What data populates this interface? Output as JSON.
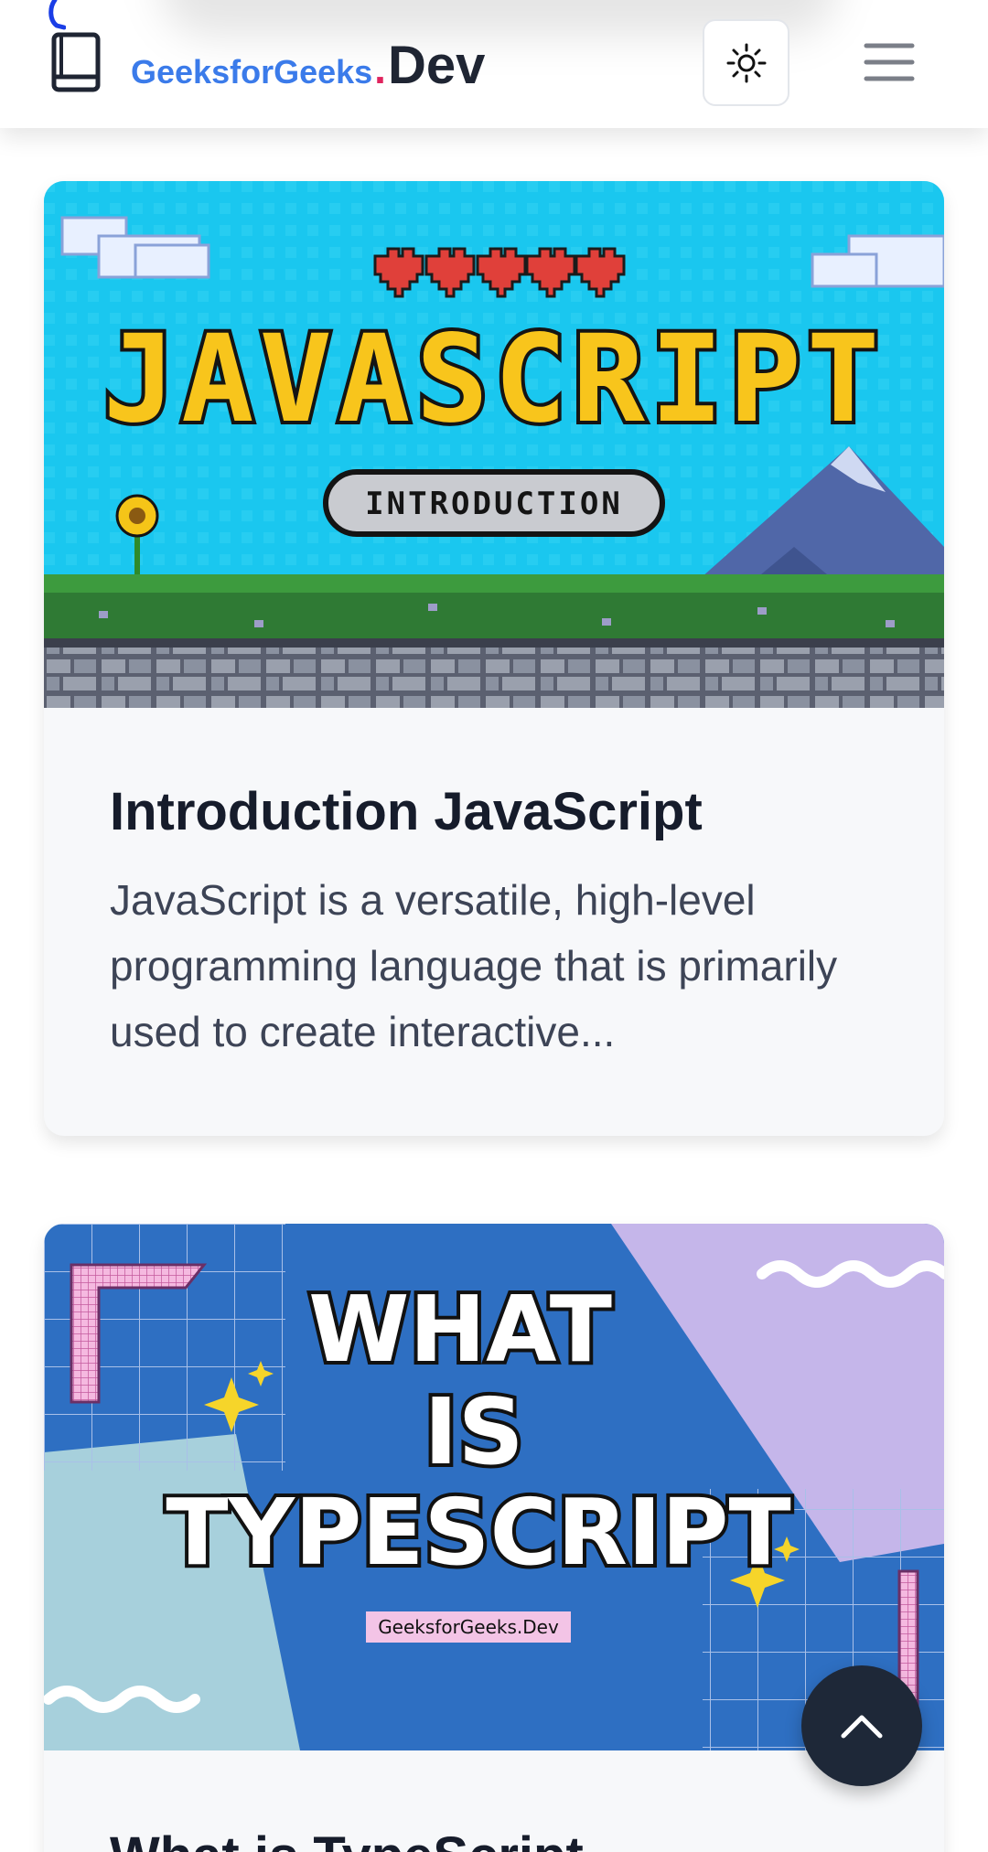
{
  "header": {
    "logo_primary": "GeeksforGeeks",
    "logo_dot": ".",
    "logo_suffix": "Dev",
    "icons": {
      "book": "book-icon",
      "theme_toggle": "sun-icon",
      "menu": "hamburger-menu-icon"
    }
  },
  "posts": [
    {
      "image": {
        "headline": "JAVASCRIPT",
        "badge": "INTRODUCTION"
      },
      "title": "Introduction JavaScript",
      "description": "JavaScript is a versatile, high-level programming language that is primarily used to create interactive..."
    },
    {
      "image": {
        "line1": "WHAT",
        "line2": "IS",
        "line3": "TYPESCRIPT",
        "watermark": "GeeksforGeeks.Dev"
      },
      "title": "What is TypeScript"
    }
  ],
  "scroll_top": {
    "icon": "chevron-up-icon"
  },
  "colors": {
    "brand_blue": "#3b7bea",
    "brand_dot": "#e0245e",
    "text_dark": "#161c2b",
    "scroll_button": "#1e2838"
  }
}
